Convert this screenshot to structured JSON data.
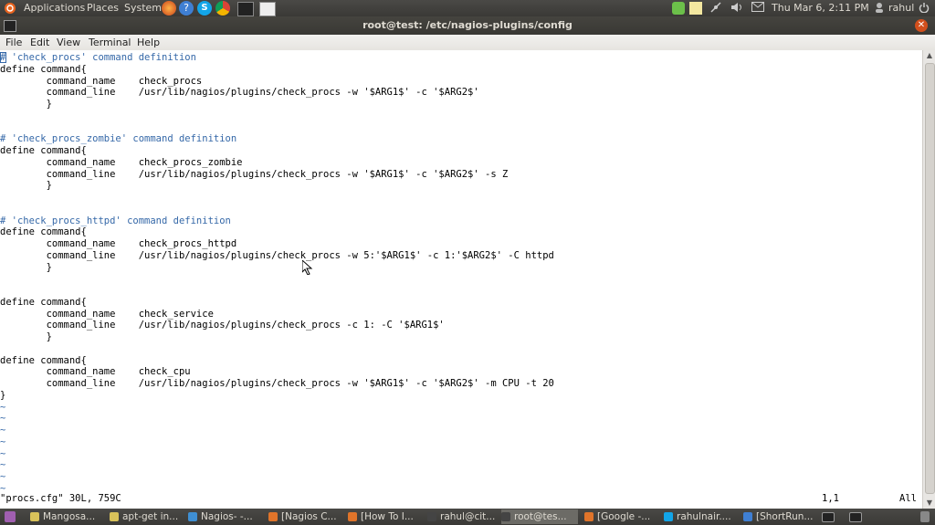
{
  "top_panel": {
    "applications": "Applications",
    "places": "Places",
    "system": "System",
    "clock": "Thu Mar  6,  2:11 PM",
    "user": "rahul"
  },
  "window": {
    "title": "root@test: /etc/nagios-plugins/config"
  },
  "menubar": {
    "file": "File",
    "edit": "Edit",
    "view": "View",
    "terminal": "Terminal",
    "help": "Help"
  },
  "editor": {
    "lines": [
      "# 'check_procs' command definition",
      "define command{",
      "        command_name    check_procs",
      "        command_line    /usr/lib/nagios/plugins/check_procs -w '$ARG1$' -c '$ARG2$'",
      "        }",
      "",
      "",
      "# 'check_procs_zombie' command definition",
      "define command{",
      "        command_name    check_procs_zombie",
      "        command_line    /usr/lib/nagios/plugins/check_procs -w '$ARG1$' -c '$ARG2$' -s Z",
      "        }",
      "",
      "",
      "# 'check_procs_httpd' command definition",
      "define command{",
      "        command_name    check_procs_httpd",
      "        command_line    /usr/lib/nagios/plugins/check_procs -w 5:'$ARG1$' -c 1:'$ARG2$' -C httpd",
      "        }",
      "",
      "",
      "define command{",
      "        command_name    check_service",
      "        command_line    /usr/lib/nagios/plugins/check_procs -c 1: -C '$ARG1$'",
      "        }",
      "",
      "define command{",
      "        command_name    check_cpu",
      "        command_line    /usr/lib/nagios/plugins/check_procs -w '$ARG1$' -c '$ARG2$' -m CPU -t 20",
      "}",
      "~",
      "~",
      "~",
      "~",
      "~",
      "~",
      "~",
      "~"
    ],
    "status_file": "\"procs.cfg\" 30L, 759C",
    "status_pos": "1,1",
    "status_all": "All"
  },
  "taskbar": {
    "tasks": [
      "Mangosa...",
      "apt-get in...",
      "Nagios- -...",
      "[Nagios C...",
      "[How To I...",
      "rahul@cit...",
      "root@tes...",
      "[Google -...",
      "rahulnair....",
      "[ShortRun..."
    ]
  },
  "colors": {
    "panel": "#3f3e3a",
    "comment": "#3568a8",
    "title_close": "#d24f1c"
  }
}
